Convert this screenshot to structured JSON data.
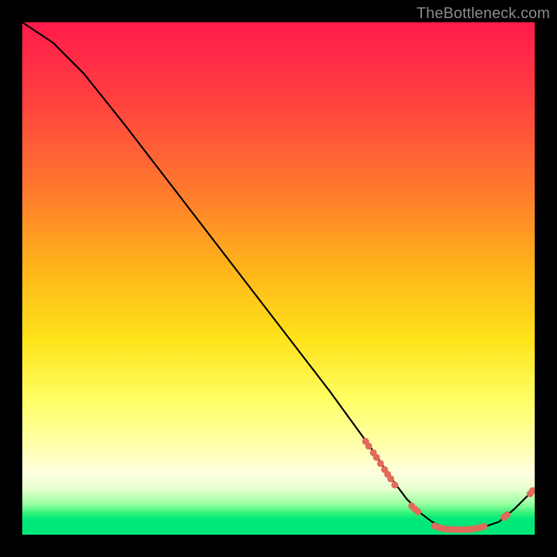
{
  "watermark": "TheBottleneck.com",
  "chart_data": {
    "type": "line",
    "title": "",
    "xlabel": "",
    "ylabel": "",
    "xlim": [
      0,
      100
    ],
    "ylim": [
      0,
      100
    ],
    "series": [
      {
        "name": "bottleneck-curve",
        "x": [
          0,
          6,
          12,
          20,
          30,
          40,
          50,
          60,
          68,
          72,
          75,
          78,
          80,
          82,
          84,
          86,
          88,
          90,
          93,
          96,
          98,
          100
        ],
        "y": [
          100,
          96,
          90,
          80,
          67,
          54,
          41,
          28,
          17,
          11,
          7,
          4,
          2.5,
          1.5,
          1,
          1,
          1,
          1.5,
          2.5,
          5,
          7,
          9
        ],
        "stroke": "#000000",
        "stroke_width": 2
      }
    ],
    "markers": [
      {
        "name": "segment-a",
        "color": "#e26a5a",
        "points": [
          {
            "x": 67.0,
            "y": 18.2
          },
          {
            "x": 67.6,
            "y": 17.3
          },
          {
            "x": 68.5,
            "y": 16.0
          },
          {
            "x": 69.1,
            "y": 15.1
          },
          {
            "x": 69.9,
            "y": 13.9
          },
          {
            "x": 70.7,
            "y": 12.7
          },
          {
            "x": 71.3,
            "y": 11.8
          },
          {
            "x": 71.9,
            "y": 10.9
          },
          {
            "x": 72.7,
            "y": 9.7
          }
        ]
      },
      {
        "name": "segment-b",
        "color": "#e26a5a",
        "points": [
          {
            "x": 76.0,
            "y": 5.6
          },
          {
            "x": 76.6,
            "y": 5.0
          },
          {
            "x": 77.2,
            "y": 4.5
          }
        ]
      },
      {
        "name": "optimal-band",
        "color": "#e26a5a",
        "points": [
          {
            "x": 80.5,
            "y": 1.7
          },
          {
            "x": 81.3,
            "y": 1.4
          },
          {
            "x": 82.1,
            "y": 1.2
          },
          {
            "x": 82.9,
            "y": 1.1
          },
          {
            "x": 83.7,
            "y": 1.0
          },
          {
            "x": 84.5,
            "y": 1.0
          },
          {
            "x": 85.3,
            "y": 1.0
          },
          {
            "x": 86.1,
            "y": 1.0
          },
          {
            "x": 86.9,
            "y": 1.0
          },
          {
            "x": 87.7,
            "y": 1.1
          },
          {
            "x": 88.5,
            "y": 1.2
          },
          {
            "x": 89.3,
            "y": 1.4
          },
          {
            "x": 90.1,
            "y": 1.6
          }
        ]
      },
      {
        "name": "segment-c",
        "color": "#e26a5a",
        "points": [
          {
            "x": 94.0,
            "y": 3.4
          },
          {
            "x": 94.6,
            "y": 3.9
          }
        ]
      },
      {
        "name": "segment-d",
        "color": "#e26a5a",
        "points": [
          {
            "x": 99.1,
            "y": 8.0
          },
          {
            "x": 99.6,
            "y": 8.6
          }
        ]
      }
    ]
  }
}
